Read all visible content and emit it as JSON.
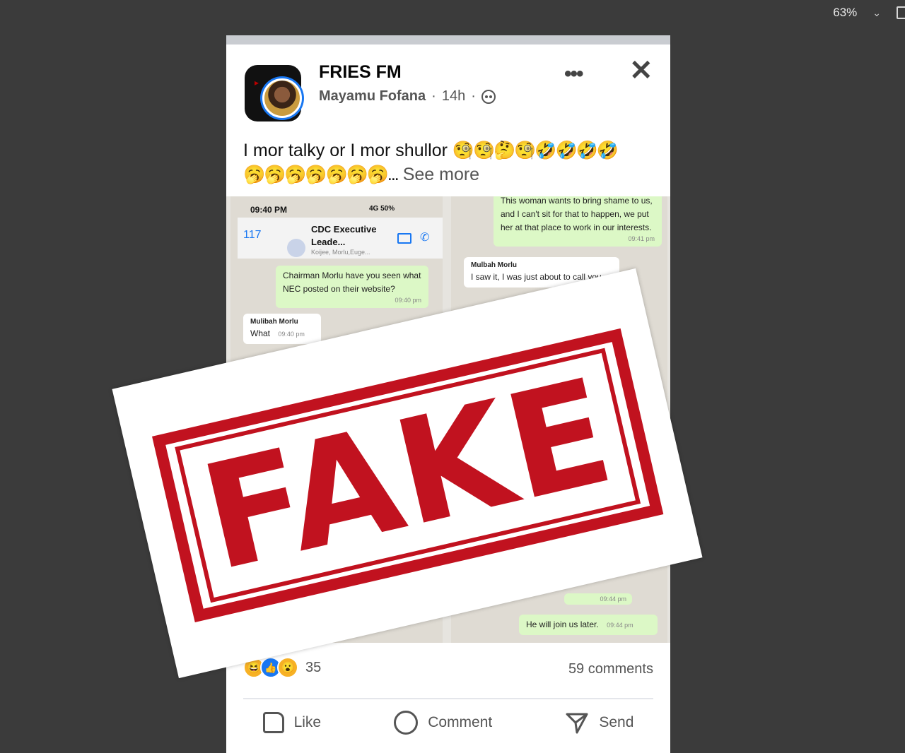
{
  "viewer": {
    "zoom": "63%"
  },
  "post": {
    "page_name": "FRIES FM",
    "author": "Mayamu Fofana",
    "time": "14h",
    "caption": "I mor talky or I mor shullor",
    "caption_emojis_1": "🧐🧐🤔🧐🤣🤣🤣🤣",
    "caption_emojis_2": "🥱🥱🥱🥱🥱🥱🥱...",
    "see_more": "See more"
  },
  "chat_left": {
    "status_time": "09:40 PM",
    "status_right": "4G 50%",
    "back_count": "117",
    "chat_title": "CDC Executive Leade...",
    "chat_subtitle": "Koijee, Morlu,Euge...",
    "msg1_text": "Chairman Morlu have you seen what NEC posted on their website?",
    "msg1_time": "09:40 pm",
    "msg2_sender": "Mulibah Morlu",
    "msg2_text": "What",
    "msg2_time": "09:40 pm"
  },
  "chat_right": {
    "msg1_text": "This woman wants to bring shame to us, and I can't sit for that to happen, we put her at that place to work in our interests.",
    "msg1_time": "09:41 pm",
    "msg2_sender": "Mulbah Morlu",
    "msg2_text": "I saw it, I was just about to call you.",
    "msg3_time": "09:44 pm",
    "msg4_text": "He will join us later.",
    "msg4_time": "09:44 pm"
  },
  "stamp": {
    "text": "FAKE",
    "color": "#c1121f"
  },
  "footer": {
    "reaction_count": "35",
    "comments": "59 comments",
    "like_label": "Like",
    "comment_label": "Comment",
    "send_label": "Send"
  },
  "icons": [
    "chevron-down-icon",
    "fit-page-icon",
    "more-icon",
    "close-icon",
    "globe-icon",
    "like-icon",
    "comment-icon",
    "send-icon"
  ]
}
